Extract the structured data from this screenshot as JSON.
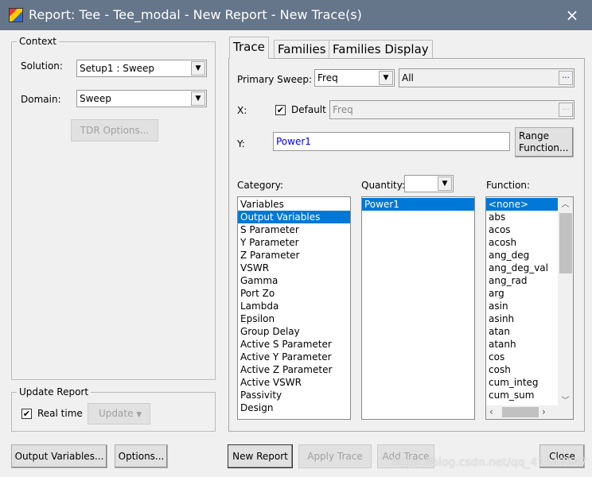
{
  "window": {
    "title": "Report: Tee - Tee_modal - New Report - New Trace(s)",
    "close_icon": "×"
  },
  "context": {
    "label": "Context",
    "solution_label": "Solution:",
    "solution_value": "Setup1 : Sweep",
    "domain_label": "Domain:",
    "domain_value": "Sweep",
    "tdr_button": "TDR Options..."
  },
  "update_report": {
    "label": "Update Report",
    "realtime_label": "Real time",
    "realtime_checked": true,
    "update_button": "Update"
  },
  "tabs": [
    {
      "label": "Trace",
      "active": true
    },
    {
      "label": "Families"
    },
    {
      "label": "Families Display"
    }
  ],
  "trace": {
    "primary_sweep_label": "Primary Sweep:",
    "primary_sweep_value": "Freq",
    "sweep_range_value": "All",
    "x_label": "X:",
    "default_label": "Default",
    "default_checked": true,
    "x_value": "Freq",
    "y_label": "Y:",
    "y_value": "Power1",
    "range_function_button_line1": "Range",
    "range_function_button_line2": "Function...",
    "category_label": "Category:",
    "quantity_label": "Quantity:",
    "function_label": "Function:",
    "categories": [
      "Variables",
      "Output Variables",
      "S Parameter",
      "Y Parameter",
      "Z Parameter",
      "VSWR",
      "Gamma",
      "Port Zo",
      "Lambda",
      "Epsilon",
      "Group Delay",
      "Active S Parameter",
      "Active Y Parameter",
      "Active Z Parameter",
      "Active VSWR",
      "Passivity",
      "Design"
    ],
    "selected_category": "Output Variables",
    "quantities": [
      "Power1"
    ],
    "functions": [
      "<none>",
      "abs",
      "acos",
      "acosh",
      "ang_deg",
      "ang_deg_val",
      "ang_rad",
      "arg",
      "asin",
      "asinh",
      "atan",
      "atanh",
      "cos",
      "cosh",
      "cum_integ",
      "cum_sum"
    ]
  },
  "footer": {
    "output_variables": "Output Variables...",
    "options": "Options...",
    "new_report": "New Report",
    "apply_trace": "Apply Trace",
    "add_trace": "Add Trace",
    "close": "Close"
  },
  "watermark": "https://blog.csdn.net/qq_41542947"
}
